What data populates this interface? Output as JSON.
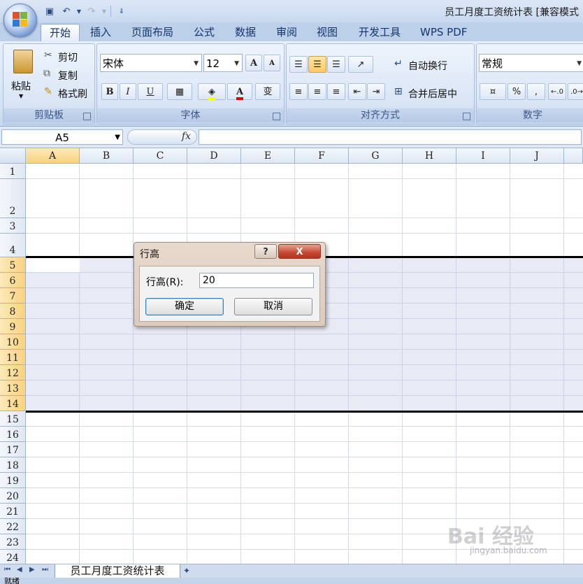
{
  "window": {
    "title": "员工月度工资统计表 [兼容模式"
  },
  "qat": {
    "save": "save-icon",
    "undo": "undo-icon",
    "redo": "redo-icon"
  },
  "tabs": [
    "开始",
    "插入",
    "页面布局",
    "公式",
    "数据",
    "审阅",
    "视图",
    "开发工具",
    "WPS PDF"
  ],
  "ribbon": {
    "clipboard": {
      "label": "剪贴板",
      "paste": "粘贴",
      "cut": "剪切",
      "copy": "复制",
      "format_painter": "格式刷"
    },
    "font": {
      "label": "字体",
      "name": "宋体",
      "size": "12",
      "bold": "B",
      "italic": "I",
      "underline": "U",
      "grow": "A",
      "shrink": "A",
      "phonetic": "变"
    },
    "alignment": {
      "label": "对齐方式",
      "wrap": "自动换行",
      "merge": "合并后居中"
    },
    "number": {
      "label": "数字",
      "format": "常规",
      "percent": "%",
      "comma": ","
    }
  },
  "formula_bar": {
    "name_box": "A5",
    "fx": "fx",
    "value": ""
  },
  "columns": [
    "A",
    "B",
    "C",
    "D",
    "E",
    "F",
    "G",
    "H",
    "I",
    "J"
  ],
  "rows": [
    "1",
    "2",
    "3",
    "4",
    "5",
    "6",
    "7",
    "8",
    "9",
    "10",
    "11",
    "12",
    "13",
    "14",
    "15",
    "16",
    "17",
    "18",
    "19",
    "20",
    "21",
    "22",
    "23",
    "24"
  ],
  "dialog": {
    "title": "行高",
    "help": "?",
    "close": "X",
    "label": "行高(R):",
    "value": "20",
    "ok": "确定",
    "cancel": "取消"
  },
  "sheets": [
    "员工月度工资统计表"
  ],
  "status": {
    "text": "就绪"
  },
  "watermark": {
    "main": "Bai 经验",
    "sub": "jingyan.baidu.com"
  }
}
